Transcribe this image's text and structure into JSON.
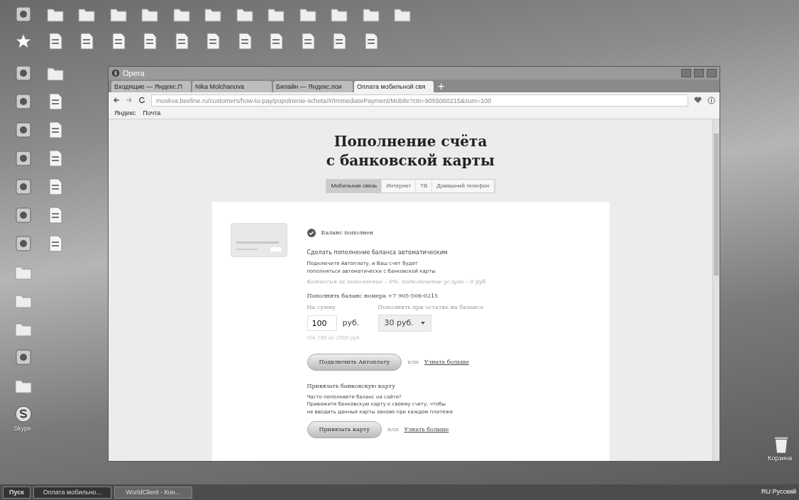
{
  "desktop": {
    "rows": [
      [
        {
          "kind": "app"
        },
        {
          "kind": "folder"
        },
        {
          "kind": "folder"
        },
        {
          "kind": "folder"
        },
        {
          "kind": "folder"
        },
        {
          "kind": "folder"
        },
        {
          "kind": "folder"
        },
        {
          "kind": "folder"
        },
        {
          "kind": "folder"
        },
        {
          "kind": "folder"
        },
        {
          "kind": "folder"
        },
        {
          "kind": "folder"
        },
        {
          "kind": "folder"
        }
      ],
      [
        {
          "kind": "star"
        },
        {
          "kind": "doc"
        },
        {
          "kind": "doc"
        },
        {
          "kind": "doc"
        },
        {
          "kind": "doc"
        },
        {
          "kind": "doc"
        },
        {
          "kind": "doc"
        },
        {
          "kind": "doc"
        },
        {
          "kind": "doc"
        },
        {
          "kind": "doc"
        },
        {
          "kind": "doc"
        },
        {
          "kind": "doc"
        }
      ],
      [
        {
          "kind": "app"
        },
        {
          "kind": "folder"
        }
      ],
      [
        {
          "kind": "app"
        },
        {
          "kind": "doc"
        }
      ],
      [
        {
          "kind": "app"
        },
        {
          "kind": "doc"
        }
      ],
      [
        {
          "kind": "app"
        },
        {
          "kind": "doc"
        }
      ],
      [
        {
          "kind": "app"
        },
        {
          "kind": "doc"
        }
      ],
      [
        {
          "kind": "app"
        },
        {
          "kind": "doc"
        }
      ],
      [
        {
          "kind": "app"
        },
        {
          "kind": "doc"
        }
      ],
      [
        {
          "kind": "folder"
        }
      ],
      [
        {
          "kind": "folder"
        }
      ],
      [
        {
          "kind": "folder"
        }
      ],
      [
        {
          "kind": "app"
        }
      ],
      [
        {
          "kind": "folder"
        }
      ],
      [
        {
          "kind": "skype",
          "label": "Skype"
        }
      ]
    ],
    "recycle_bin": {
      "label": "Корзина"
    }
  },
  "browser": {
    "title": "Opera",
    "tabs": [
      {
        "label": "Входящие — Яндекс.П",
        "selected": false
      },
      {
        "label": "Nika Molchanova",
        "selected": false
      },
      {
        "label": "Билайн — Яндекс.пои",
        "selected": false
      },
      {
        "label": "Оплата мобильной свя",
        "selected": true
      }
    ],
    "new_tab": "+",
    "address": "moskva.beeline.ru/customers/how-to-pay/popolnenie-scheta/#/ImmediatePayment/Mobile?ctn=9055060215&sum=100",
    "bookmarks": [
      "Яндекс",
      "Почта"
    ]
  },
  "page": {
    "title_lines": [
      "Пополнение счёта",
      "с банковской карты"
    ],
    "tabs": [
      {
        "label": "Мобильная связь",
        "selected": true
      },
      {
        "label": "Интернет",
        "selected": false
      },
      {
        "label": "ТВ",
        "selected": false
      },
      {
        "label": "Домашний телефон",
        "selected": false
      }
    ],
    "status": "Баланс пополнен",
    "autopay": {
      "heading": "Сделать пополнение баланса автоматическим",
      "text": "Подключите Автоплату, и Ваш счет будет пополняться автоматически с банковской карты",
      "fee": "Комиссия за пополнение – 0%, подключение услуги – 0 руб",
      "number_line": "Пополнять баланс номера +7 905-506-0215",
      "amount_label": "На сумму",
      "amount": "100",
      "currency": "руб.",
      "threshold_label": "Пополнять при остатке на балансе",
      "threshold": "30 руб.",
      "hint": "От 100 до 2000 руб",
      "button": "Подключить Автоплату",
      "or": "или",
      "more": "Узнать больше"
    },
    "bind": {
      "heading": "Привязать банковскую карту",
      "text_lines": [
        "Часто пополняете баланс на сайте?",
        "Привяжите банковскую карту к своему счету, чтобы",
        "не вводить данные карты заново при каждом платеже"
      ],
      "button": "Привязать карту",
      "or": "или",
      "more": "Узнать больше"
    }
  },
  "taskbar": {
    "start": "Пуск",
    "tasks": [
      {
        "label": "Оплата мобильно...",
        "selected": true
      },
      {
        "label": "WorldClient - Кон...",
        "selected": false
      }
    ],
    "language": "RU Русский"
  }
}
